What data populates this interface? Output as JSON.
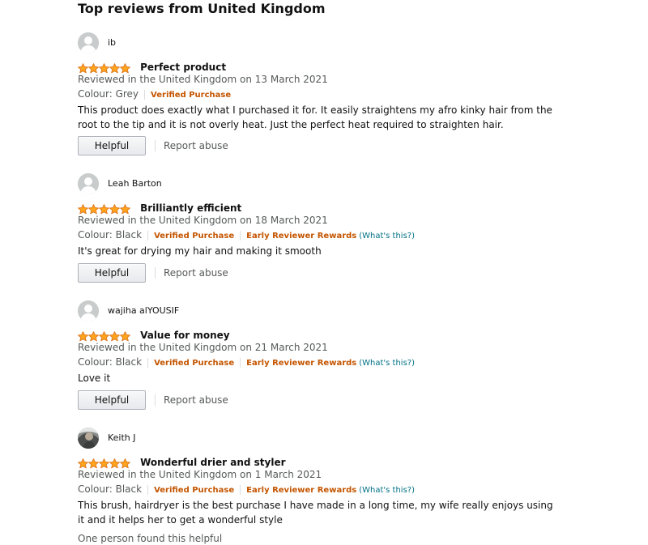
{
  "heading": "Top reviews from United Kingdom",
  "colors": {
    "star": "#ffa41c",
    "star_border": "#de7921",
    "badge": "#c45500",
    "link": "#007185",
    "muted": "#565959"
  },
  "reviews": [
    {
      "author": "ib",
      "avatar_icon": "default-avatar-icon",
      "rating": 5,
      "title": "Perfect product",
      "date": "Reviewed in the United Kingdom on 13 March 2021",
      "colour": "Colour: Grey",
      "verified": "Verified Purchase",
      "body": "This product does exactly what I purchased it for. It easily straightens my afro kinky hair from the root to the tip and it is not overly heat. Just the perfect heat required to straighten hair.",
      "helpful_label": "Helpful",
      "report_label": "Report abuse"
    },
    {
      "author": "Leah Barton",
      "avatar_icon": "default-avatar-icon",
      "rating": 5,
      "title": "Brilliantly efficient",
      "date": "Reviewed in the United Kingdom on 18 March 2021",
      "colour": "Colour: Black",
      "verified": "Verified Purchase",
      "reward": "Early Reviewer Rewards",
      "reward_help": "(What's this?)",
      "body": "It's great for drying my hair and making it smooth",
      "helpful_label": "Helpful",
      "report_label": "Report abuse"
    },
    {
      "author": "wajiha alYOUSIF",
      "avatar_icon": "default-avatar-icon",
      "rating": 5,
      "title": "Value for money",
      "date": "Reviewed in the United Kingdom on 21 March 2021",
      "colour": "Colour: Black",
      "verified": "Verified Purchase",
      "reward": "Early Reviewer Rewards",
      "reward_help": "(What's this?)",
      "body": "Love it",
      "helpful_label": "Helpful",
      "report_label": "Report abuse"
    },
    {
      "author": "Keith J",
      "avatar_icon": "photo-avatar-icon",
      "rating": 5,
      "title": "Wonderful drier and styler",
      "date": "Reviewed in the United Kingdom on 1 March 2021",
      "colour": "Colour: Black",
      "verified": "Verified Purchase",
      "reward": "Early Reviewer Rewards",
      "reward_help": "(What's this?)",
      "body": "This brush, hairdryer is the best purchase I have made in a long time, my wife really enjoys using it and it helps her to get a wonderful style",
      "found_helpful": "One person found this helpful"
    }
  ]
}
